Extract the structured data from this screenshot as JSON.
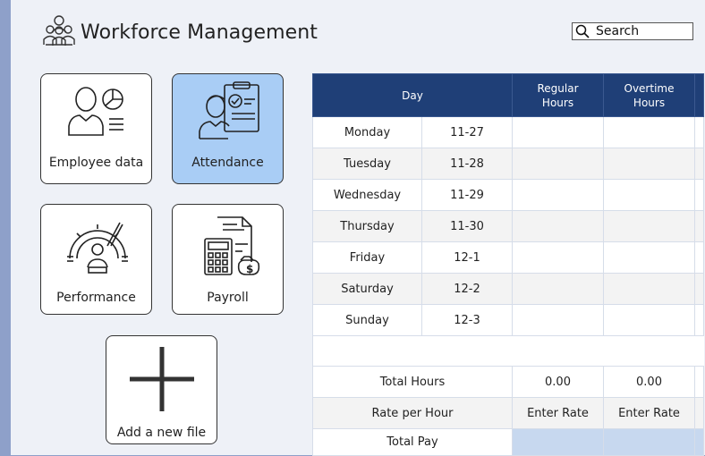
{
  "app": {
    "title": "Workforce Management"
  },
  "search": {
    "label": "Search"
  },
  "tiles": [
    {
      "id": "employee",
      "label": "Employee data",
      "active": false
    },
    {
      "id": "attendance",
      "label": "Attendance",
      "active": true
    },
    {
      "id": "performance",
      "label": "Performance",
      "active": false
    },
    {
      "id": "payroll",
      "label": "Payroll",
      "active": false
    },
    {
      "id": "add",
      "label": "Add a new file",
      "active": false
    }
  ],
  "table": {
    "headers": {
      "day": "Day",
      "regular": "Regular Hours",
      "overtime": "Overtime Hours"
    },
    "rows": [
      {
        "day": "Monday",
        "date": "11-27"
      },
      {
        "day": "Tuesday",
        "date": "11-28"
      },
      {
        "day": "Wednesday",
        "date": "11-29"
      },
      {
        "day": "Thursday",
        "date": "11-30"
      },
      {
        "day": "Friday",
        "date": "12-1"
      },
      {
        "day": "Saturday",
        "date": "12-2"
      },
      {
        "day": "Sunday",
        "date": "12-3"
      }
    ],
    "totals": {
      "total_hours_label": "Total Hours",
      "total_regular": "0.00",
      "total_overtime": "0.00",
      "rate_label": "Rate per Hour",
      "rate_regular": "Enter Rate",
      "rate_overtime": "Enter Rate",
      "total_pay_label": "Total Pay"
    }
  },
  "colors": {
    "header_bg": "#1f3f77",
    "active_tile": "#a9cdf5",
    "total_pay_cell": "#c7d8ef",
    "side_strip": "#8ea0c9"
  }
}
